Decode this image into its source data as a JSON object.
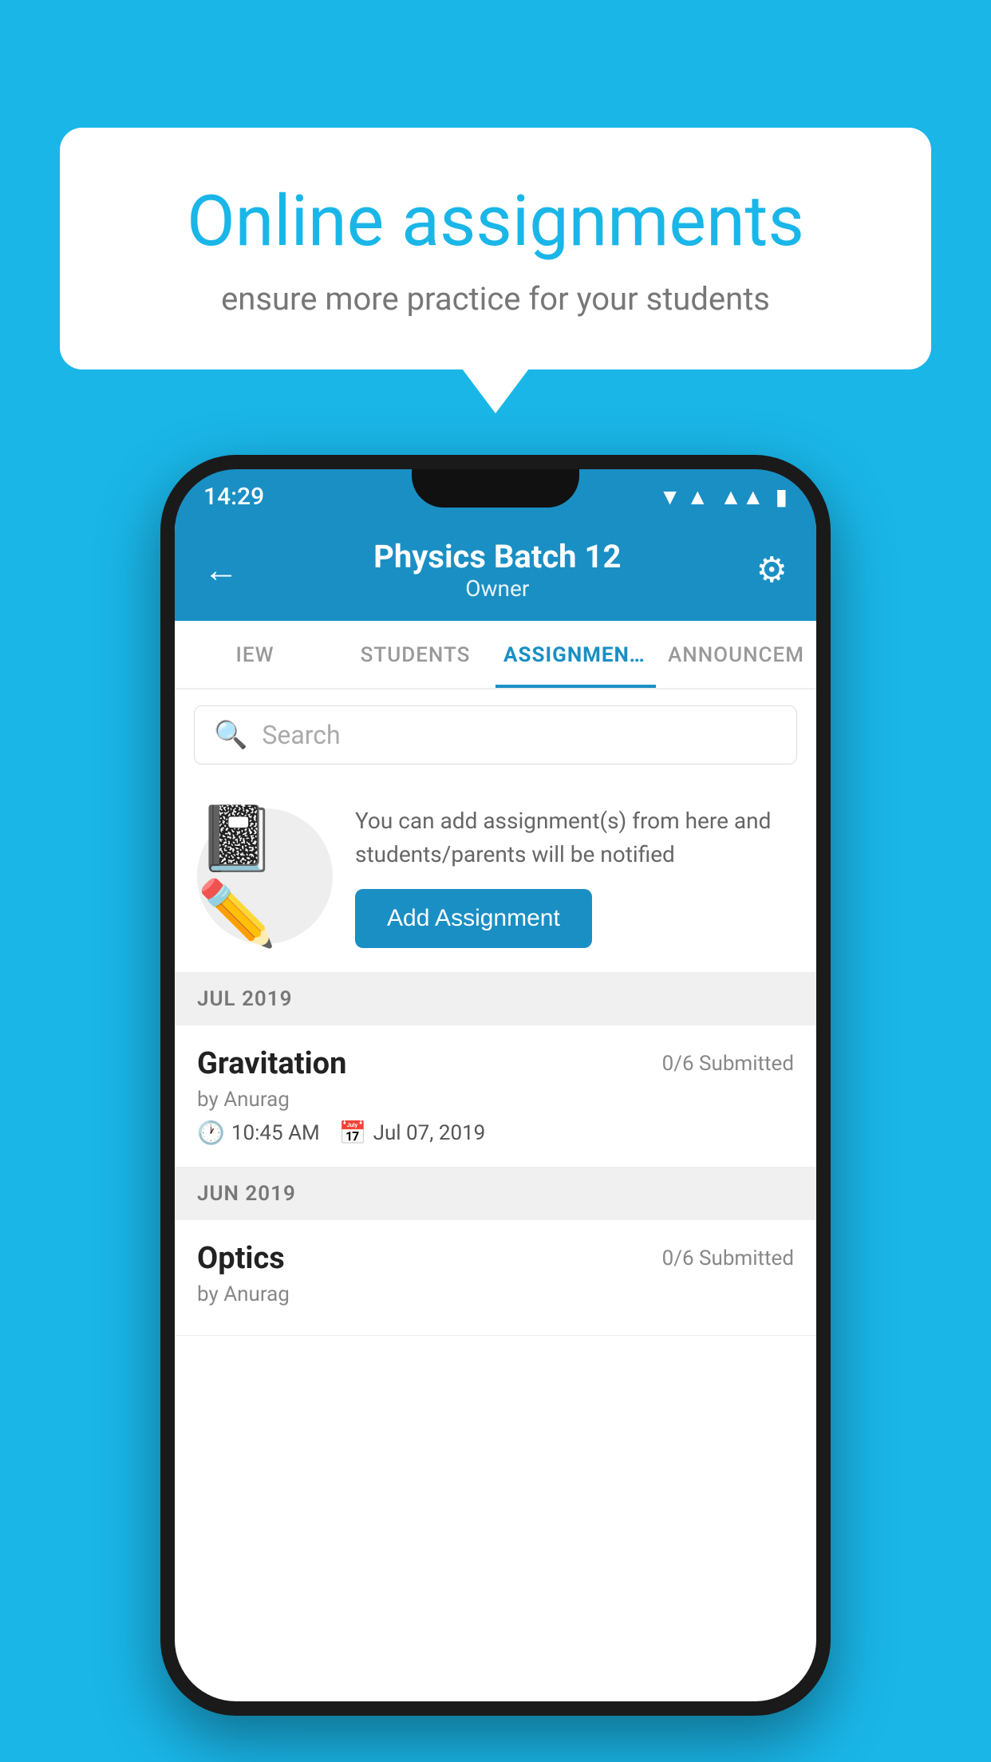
{
  "background_color": "#1ab6e8",
  "speech_bubble": {
    "title": "Online assignments",
    "subtitle": "ensure more practice for your students"
  },
  "status_bar": {
    "time": "14:29",
    "wifi_symbol": "▼",
    "signal_symbol": "◂",
    "battery_symbol": "▮"
  },
  "header": {
    "title": "Physics Batch 12",
    "subtitle": "Owner",
    "back_label": "←",
    "settings_label": "⚙"
  },
  "tabs": [
    {
      "label": "IEW",
      "active": false
    },
    {
      "label": "STUDENTS",
      "active": false
    },
    {
      "label": "ASSIGNMENTS",
      "active": true
    },
    {
      "label": "ANNOUNCEM",
      "active": false
    }
  ],
  "search": {
    "placeholder": "Search"
  },
  "promo": {
    "description": "You can add assignment(s) from here and students/parents will be notified",
    "button_label": "Add Assignment"
  },
  "sections": [
    {
      "month": "JUL 2019",
      "assignments": [
        {
          "title": "Gravitation",
          "submitted": "0/6 Submitted",
          "author": "by Anurag",
          "time": "10:45 AM",
          "date": "Jul 07, 2019"
        }
      ]
    },
    {
      "month": "JUN 2019",
      "assignments": [
        {
          "title": "Optics",
          "submitted": "0/6 Submitted",
          "author": "by Anurag",
          "time": "",
          "date": ""
        }
      ]
    }
  ]
}
